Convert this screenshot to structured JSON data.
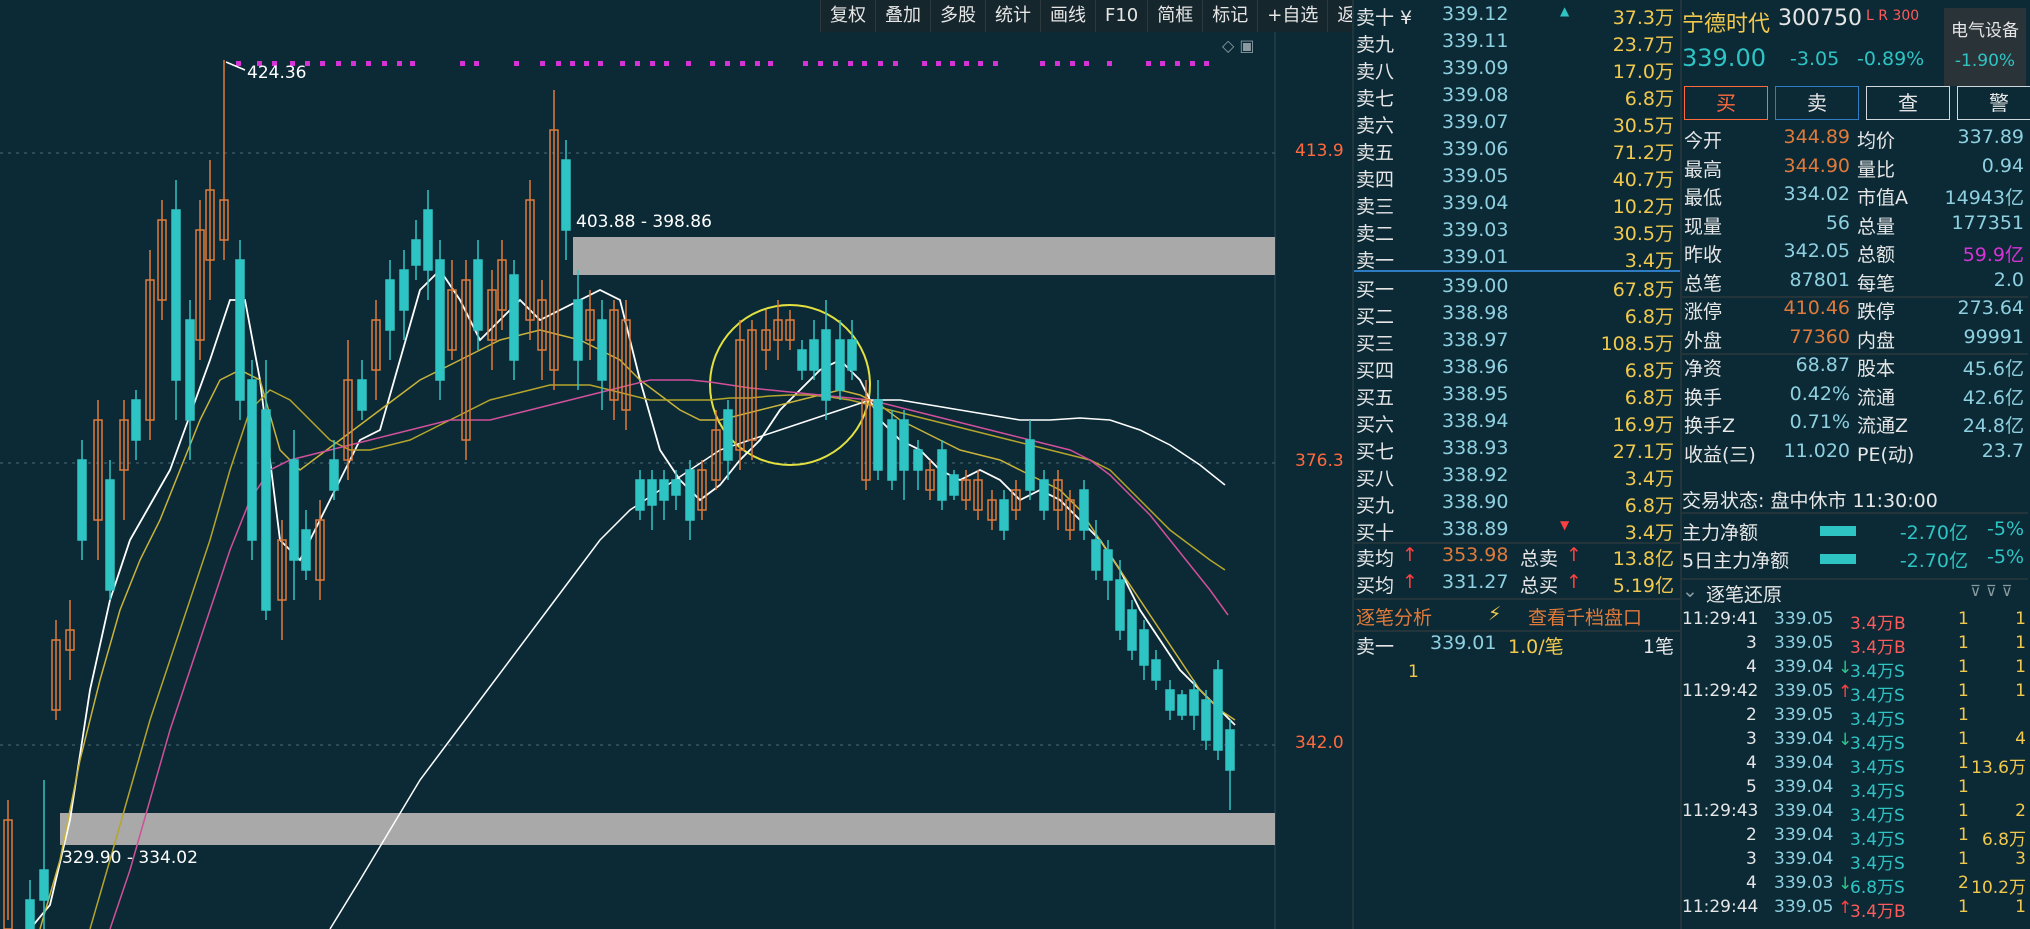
{
  "toolbar": [
    "复权",
    "叠加",
    "多股",
    "统计",
    "画线",
    "F10",
    "简框",
    "标记",
    "+自选",
    "返回"
  ],
  "chart": {
    "high_label": "424.36",
    "zone_top_label": "403.88 - 398.86",
    "zone_bottom_label": "329.90 - 334.02",
    "y_labels": [
      "413.9",
      "376.3",
      "342.0"
    ]
  },
  "orderbook": {
    "asks": [
      {
        "label": "卖十 ¥",
        "price": "339.12",
        "vol": "37.3万"
      },
      {
        "label": "卖九",
        "price": "339.11",
        "vol": "23.7万"
      },
      {
        "label": "卖八",
        "price": "339.09",
        "vol": "17.0万"
      },
      {
        "label": "卖七",
        "price": "339.08",
        "vol": "6.8万"
      },
      {
        "label": "卖六",
        "price": "339.07",
        "vol": "30.5万"
      },
      {
        "label": "卖五",
        "price": "339.06",
        "vol": "71.2万"
      },
      {
        "label": "卖四",
        "price": "339.05",
        "vol": "40.7万"
      },
      {
        "label": "卖三",
        "price": "339.04",
        "vol": "10.2万"
      },
      {
        "label": "卖二",
        "price": "339.03",
        "vol": "30.5万"
      },
      {
        "label": "卖一",
        "price": "339.01",
        "vol": "3.4万"
      }
    ],
    "bids": [
      {
        "label": "买一",
        "price": "339.00",
        "vol": "67.8万"
      },
      {
        "label": "买二",
        "price": "338.98",
        "vol": "6.8万"
      },
      {
        "label": "买三",
        "price": "338.97",
        "vol": "108.5万"
      },
      {
        "label": "买四",
        "price": "338.96",
        "vol": "6.8万"
      },
      {
        "label": "买五",
        "price": "338.95",
        "vol": "6.8万"
      },
      {
        "label": "买六",
        "price": "338.94",
        "vol": "16.9万"
      },
      {
        "label": "买七",
        "price": "338.93",
        "vol": "27.1万"
      },
      {
        "label": "买八",
        "price": "338.92",
        "vol": "3.4万"
      },
      {
        "label": "买九",
        "price": "338.90",
        "vol": "6.8万"
      },
      {
        "label": "买十",
        "price": "338.89",
        "vol": "3.4万"
      }
    ],
    "avg_sell_label": "卖均",
    "avg_sell": "353.98",
    "total_sell_label": "总卖",
    "total_sell": "13.8亿",
    "avg_buy_label": "买均",
    "avg_buy": "331.27",
    "total_buy_label": "总买",
    "total_buy": "5.19亿",
    "tick_title": "逐笔分析",
    "tick_link": "查看千档盘口",
    "tick_row": {
      "label": "卖一",
      "price": "339.01",
      "per": "1.0/笔",
      "count": "1笔"
    },
    "tick_sub": "1"
  },
  "stock": {
    "name": "宁德时代",
    "code": "300750",
    "tag": "L R 300",
    "sector": "电气设备",
    "sector_chg": "-1.90%",
    "price": "339.00",
    "change": "-3.05",
    "pct": "-0.89%"
  },
  "actions": [
    "买",
    "卖",
    "查",
    "警"
  ],
  "stats": [
    [
      "今开",
      "344.89",
      "均价",
      "337.89"
    ],
    [
      "最高",
      "344.90",
      "量比",
      "0.94"
    ],
    [
      "最低",
      "334.02",
      "市值A",
      "14943亿"
    ],
    [
      "现量",
      "56",
      "总量",
      "177351"
    ],
    [
      "昨收",
      "342.05",
      "总额",
      "59.9亿"
    ],
    [
      "总笔",
      "87801",
      "每笔",
      "2.0"
    ],
    [
      "涨停",
      "410.46",
      "跌停",
      "273.64"
    ],
    [
      "外盘",
      "77360",
      "内盘",
      "99991"
    ],
    [
      "净资",
      "68.87",
      "股本",
      "45.6亿"
    ],
    [
      "换手",
      "0.42%",
      "流通",
      "42.6亿"
    ],
    [
      "换手Z",
      "0.71%",
      "流通Z",
      "24.8亿"
    ],
    [
      "收益(三)",
      "11.020",
      "PE(动)",
      "23.7"
    ]
  ],
  "trade_status": "交易状态: 盘中休市 11:30:00",
  "flows": [
    {
      "label": "主力净额",
      "value": "-2.70亿",
      "pct": "-5%"
    },
    {
      "label": "5日主力净额",
      "value": "-2.70亿",
      "pct": "-5%"
    }
  ],
  "trades_title": "逐笔还原",
  "trades": [
    {
      "t": "11:29:41",
      "p": "339.05",
      "v": "3.4万B",
      "a": "1",
      "b": "1"
    },
    {
      "t": "3",
      "p": "339.05",
      "v": "3.4万B",
      "a": "1",
      "b": "1"
    },
    {
      "t": "4",
      "p": "339.04",
      "v": "3.4万S",
      "a": "1",
      "b": "1"
    },
    {
      "t": "11:29:42",
      "p": "339.05",
      "v": "3.4万S",
      "a": "1",
      "b": "1"
    },
    {
      "t": "2",
      "p": "339.05",
      "v": "3.4万S",
      "a": "1",
      "b": ""
    },
    {
      "t": "3",
      "p": "339.04",
      "v": "3.4万S",
      "a": "1",
      "b": "4"
    },
    {
      "t": "4",
      "p": "339.04",
      "v": "3.4万S",
      "a": "1",
      "b": "13.6万"
    },
    {
      "t": "5",
      "p": "339.04",
      "v": "3.4万S",
      "a": "1",
      "b": ""
    },
    {
      "t": "11:29:43",
      "p": "339.04",
      "v": "3.4万S",
      "a": "1",
      "b": "2"
    },
    {
      "t": "2",
      "p": "339.04",
      "v": "3.4万S",
      "a": "1",
      "b": "6.8万"
    },
    {
      "t": "3",
      "p": "339.04",
      "v": "3.4万S",
      "a": "1",
      "b": "3"
    },
    {
      "t": "4",
      "p": "339.03",
      "v": "6.8万S",
      "a": "2",
      "b": "10.2万"
    },
    {
      "t": "11:29:44",
      "p": "339.05",
      "v": "3.4万B",
      "a": "1",
      "b": "1"
    }
  ]
}
